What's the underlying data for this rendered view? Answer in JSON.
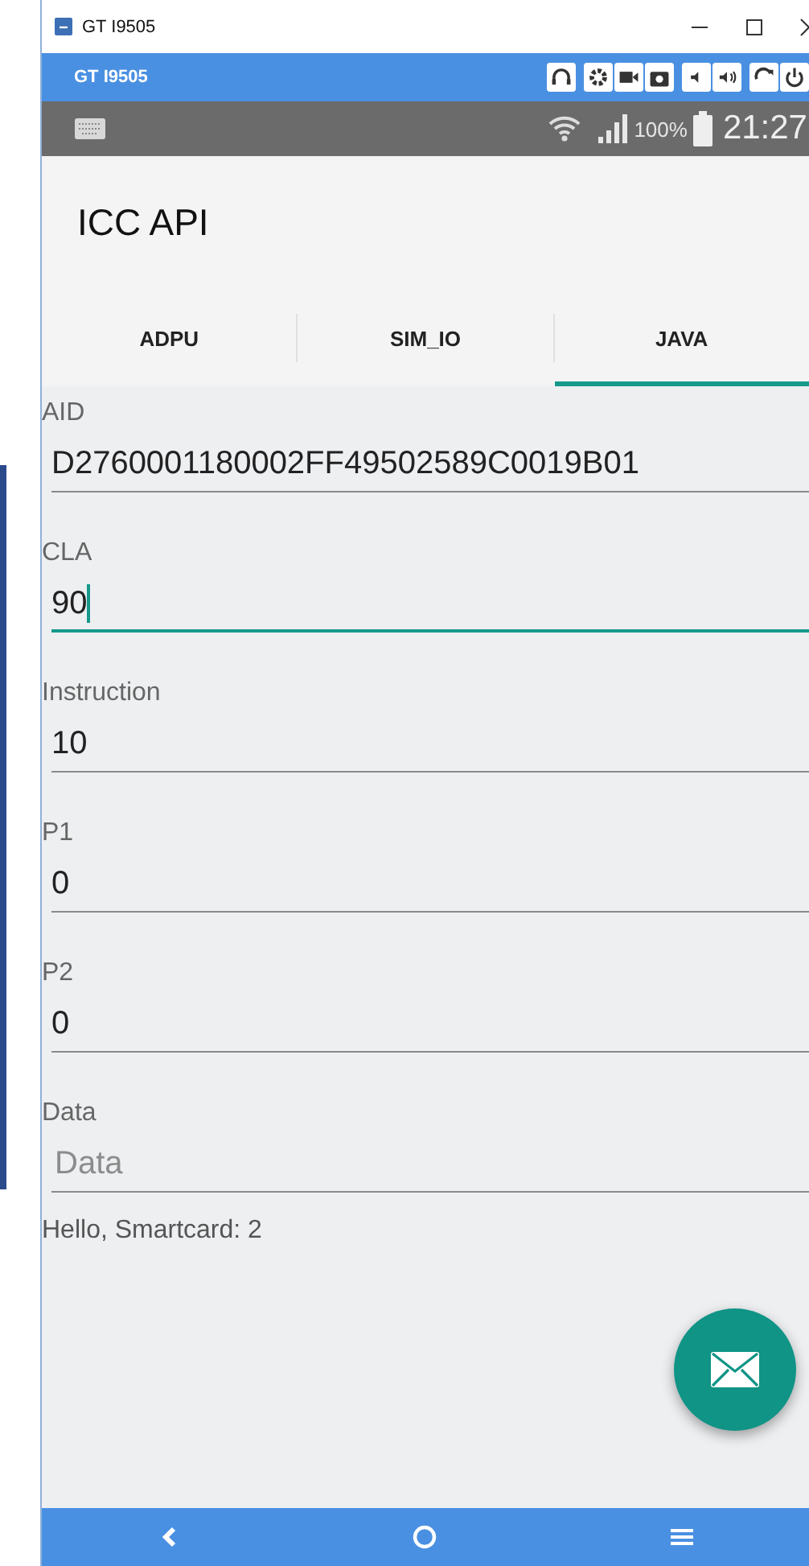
{
  "window": {
    "title": "GT I9505"
  },
  "toolbar": {
    "device": "GT I9505"
  },
  "status_bar": {
    "battery": "100%",
    "time": "21:27"
  },
  "app_bar": {
    "title": "ICC API"
  },
  "tabs": [
    {
      "label": "ADPU",
      "selected": false
    },
    {
      "label": "SIM_IO",
      "selected": false
    },
    {
      "label": "JAVA",
      "selected": true
    }
  ],
  "fields": [
    {
      "label": "AID",
      "value": "D2760001180002FF49502589C0019B01",
      "focused": false
    },
    {
      "label": "CLA",
      "value": "90",
      "focused": true
    },
    {
      "label": "Instruction",
      "value": "10",
      "focused": false
    },
    {
      "label": "P1",
      "value": "0",
      "focused": false
    },
    {
      "label": "P2",
      "value": "0",
      "focused": false
    },
    {
      "label": "Data",
      "placeholder": "Data",
      "focused": false
    }
  ],
  "result": "Hello, Smartcard: 2"
}
